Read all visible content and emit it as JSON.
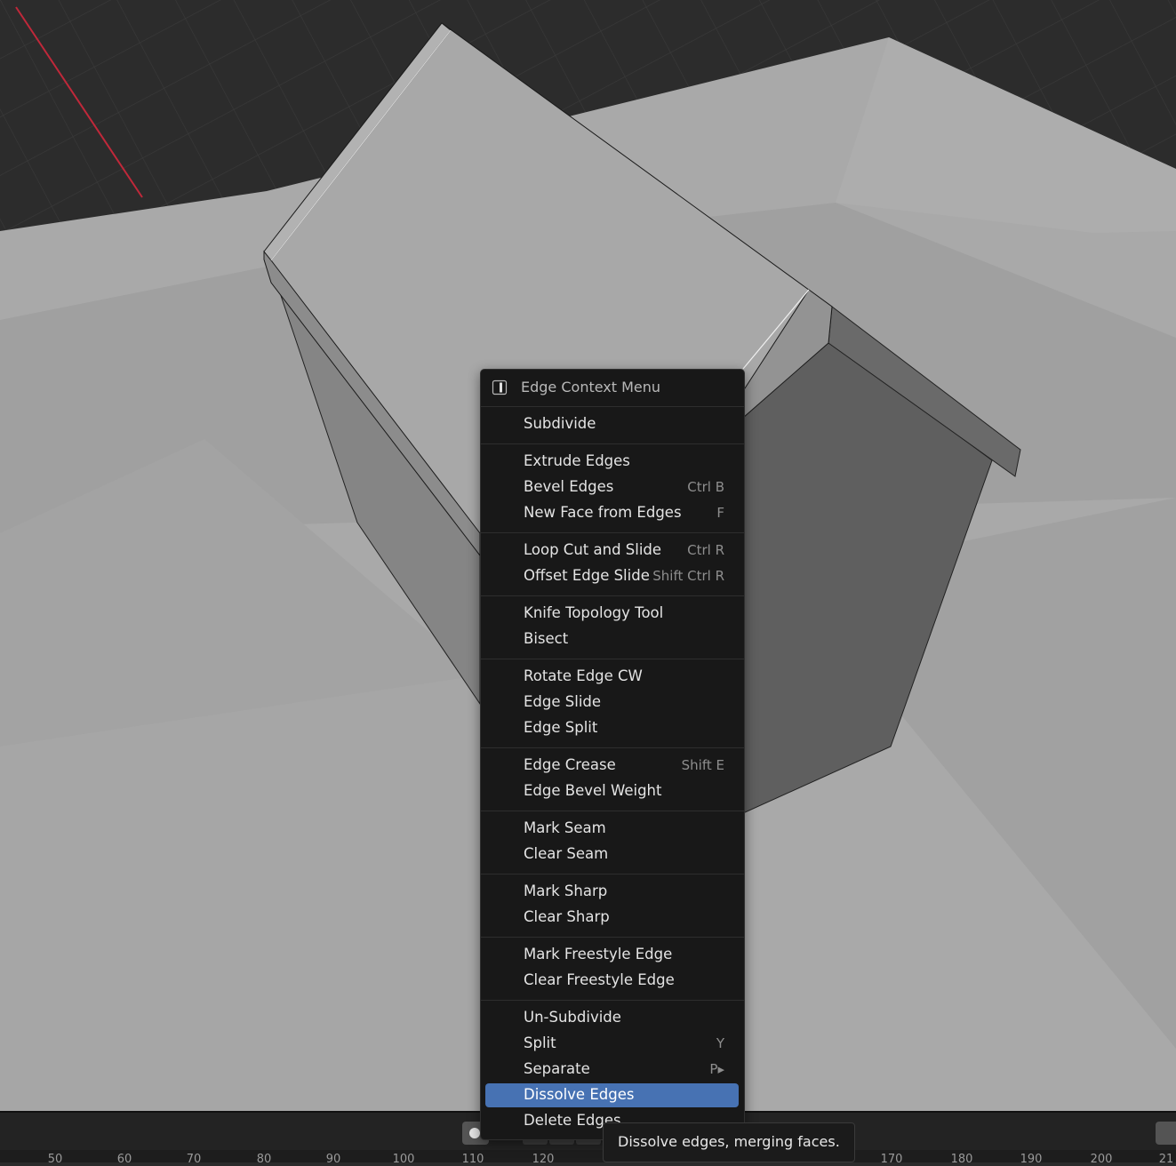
{
  "menu": {
    "title": "Edge Context Menu",
    "items": [
      {
        "label": "Subdivide",
        "shortcut": ""
      },
      {
        "label": "Extrude Edges",
        "shortcut": ""
      },
      {
        "label": "Bevel Edges",
        "shortcut": "Ctrl B"
      },
      {
        "label": "New Face from Edges",
        "shortcut": "F"
      },
      {
        "label": "Loop Cut and Slide",
        "shortcut": "Ctrl R"
      },
      {
        "label": "Offset Edge Slide",
        "shortcut": "Shift Ctrl R"
      },
      {
        "label": "Knife Topology Tool",
        "shortcut": ""
      },
      {
        "label": "Bisect",
        "shortcut": ""
      },
      {
        "label": "Rotate Edge CW",
        "shortcut": ""
      },
      {
        "label": "Edge Slide",
        "shortcut": ""
      },
      {
        "label": "Edge Split",
        "shortcut": ""
      },
      {
        "label": "Edge Crease",
        "shortcut": "Shift E"
      },
      {
        "label": "Edge Bevel Weight",
        "shortcut": ""
      },
      {
        "label": "Mark Seam",
        "shortcut": ""
      },
      {
        "label": "Clear Seam",
        "shortcut": ""
      },
      {
        "label": "Mark Sharp",
        "shortcut": ""
      },
      {
        "label": "Clear Sharp",
        "shortcut": ""
      },
      {
        "label": "Mark Freestyle Edge",
        "shortcut": ""
      },
      {
        "label": "Clear Freestyle Edge",
        "shortcut": ""
      },
      {
        "label": "Un-Subdivide",
        "shortcut": ""
      },
      {
        "label": "Split",
        "shortcut": "Y"
      },
      {
        "label": "Separate",
        "shortcut": "P▸"
      },
      {
        "label": "Dissolve Edges",
        "shortcut": ""
      },
      {
        "label": "Delete Edges",
        "shortcut": ""
      }
    ],
    "active_item": "Dissolve Edges"
  },
  "tooltip": {
    "text": "Dissolve edges, merging faces."
  },
  "timeline": {
    "ticks": [
      "50",
      "60",
      "70",
      "80",
      "90",
      "100",
      "110",
      "120",
      "170",
      "180",
      "190",
      "200",
      "21"
    ]
  },
  "colors": {
    "menu_bg": "#181818",
    "highlight": "#4772b3",
    "x_axis": "#c0283a",
    "grid_bg": "#2c2c2c",
    "floor": "#a8a8a8",
    "object_top": "#a6a6a6"
  },
  "icons": {
    "menu_header": "edge-select-mode-icon"
  }
}
